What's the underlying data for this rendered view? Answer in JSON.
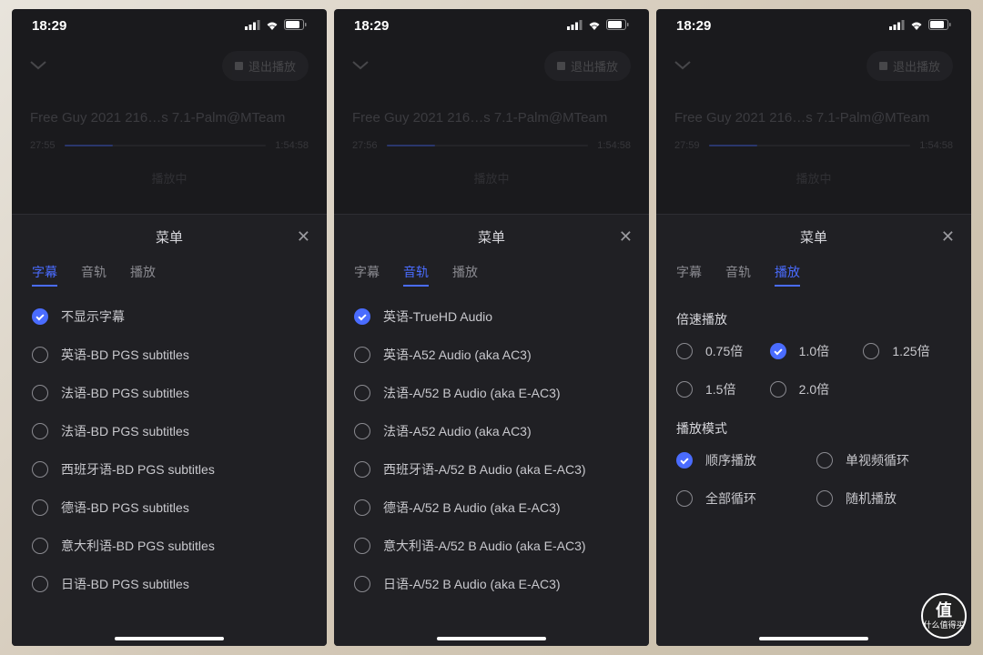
{
  "status": {
    "time": "18:29"
  },
  "exit_label": "退出播放",
  "video_title": "Free Guy 2021 216…s 7.1-Palm@MTeam",
  "play_status": "播放中",
  "total_time": "1:54:58",
  "menu_title": "菜单",
  "tabs": {
    "subtitle": "字幕",
    "audio": "音轨",
    "playback": "播放"
  },
  "screens": [
    {
      "current_time": "27:55",
      "active_tab": 0,
      "list": [
        {
          "label": "不显示字幕",
          "checked": true
        },
        {
          "label": "英语-BD PGS subtitles",
          "checked": false
        },
        {
          "label": "法语-BD PGS subtitles",
          "checked": false
        },
        {
          "label": "法语-BD PGS subtitles",
          "checked": false
        },
        {
          "label": "西班牙语-BD PGS subtitles",
          "checked": false
        },
        {
          "label": "德语-BD PGS subtitles",
          "checked": false
        },
        {
          "label": "意大利语-BD PGS subtitles",
          "checked": false
        },
        {
          "label": "日语-BD PGS subtitles",
          "checked": false
        }
      ]
    },
    {
      "current_time": "27:56",
      "active_tab": 1,
      "list": [
        {
          "label": "英语-TrueHD Audio",
          "checked": true
        },
        {
          "label": "英语-A52 Audio (aka AC3)",
          "checked": false
        },
        {
          "label": "法语-A/52 B Audio (aka E-AC3)",
          "checked": false
        },
        {
          "label": "法语-A52 Audio (aka AC3)",
          "checked": false
        },
        {
          "label": "西班牙语-A/52 B Audio (aka E-AC3)",
          "checked": false
        },
        {
          "label": "德语-A/52 B Audio (aka E-AC3)",
          "checked": false
        },
        {
          "label": "意大利语-A/52 B Audio (aka E-AC3)",
          "checked": false
        },
        {
          "label": "日语-A/52 B Audio (aka E-AC3)",
          "checked": false
        }
      ]
    },
    {
      "current_time": "27:59",
      "active_tab": 2,
      "sections": [
        {
          "title": "倍速播放",
          "cols": 3,
          "opts": [
            {
              "label": "0.75倍",
              "checked": false
            },
            {
              "label": "1.0倍",
              "checked": true
            },
            {
              "label": "1.25倍",
              "checked": false
            },
            {
              "label": "1.5倍",
              "checked": false
            },
            {
              "label": "2.0倍",
              "checked": false
            }
          ]
        },
        {
          "title": "播放模式",
          "cols": 2,
          "opts": [
            {
              "label": "顺序播放",
              "checked": true
            },
            {
              "label": "单视频循环",
              "checked": false
            },
            {
              "label": "全部循环",
              "checked": false
            },
            {
              "label": "随机播放",
              "checked": false
            }
          ]
        }
      ]
    }
  ],
  "watermark": {
    "char": "值",
    "text": "什么值得买"
  }
}
